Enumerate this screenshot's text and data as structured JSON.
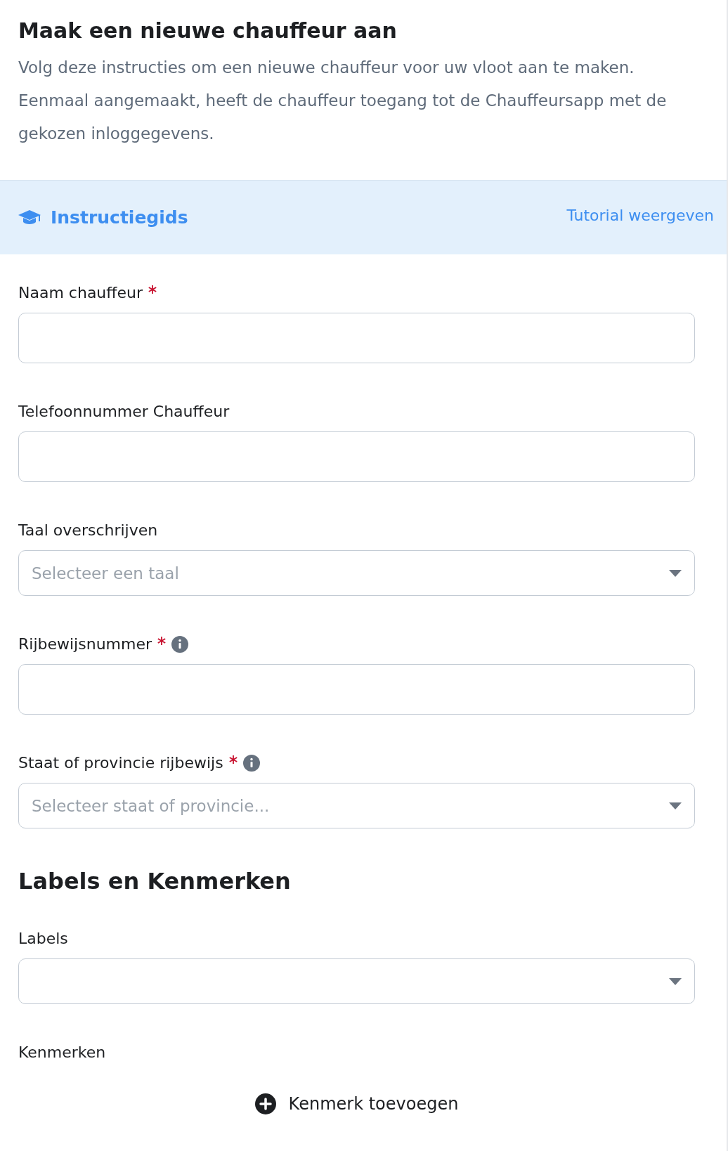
{
  "title": "Maak een nieuwe chauffeur aan",
  "description": "Volg deze instructies om een nieuwe chauffeur voor uw vloot aan te maken. Eenmaal aangemaakt, heeft de chauffeur toegang tot de Chauffeursapp met de gekozen inloggegevens.",
  "guide": {
    "title": "Instructiegids",
    "link": "Tutorial weergeven"
  },
  "fields": [
    {
      "kind": "text",
      "label": "Naam chauffeur",
      "required": true,
      "info": false
    },
    {
      "kind": "text",
      "label": "Telefoonnummer Chauffeur",
      "required": false,
      "info": false
    },
    {
      "kind": "select",
      "label": "Taal overschrijven",
      "required": false,
      "info": false,
      "placeholder": "Selecteer een taal"
    },
    {
      "kind": "text",
      "label": "Rijbewijsnummer",
      "required": true,
      "info": true
    },
    {
      "kind": "select",
      "label": "Staat of provincie rijbewijs",
      "required": true,
      "info": true,
      "placeholder": "Selecteer staat of provincie..."
    },
    {
      "kind": "heading",
      "label": "Labels en Kenmerken"
    },
    {
      "kind": "select",
      "label": "Labels",
      "required": false,
      "info": false
    },
    {
      "kind": "add",
      "label": "Kenmerken",
      "button": "Kenmerk toevoegen"
    }
  ]
}
